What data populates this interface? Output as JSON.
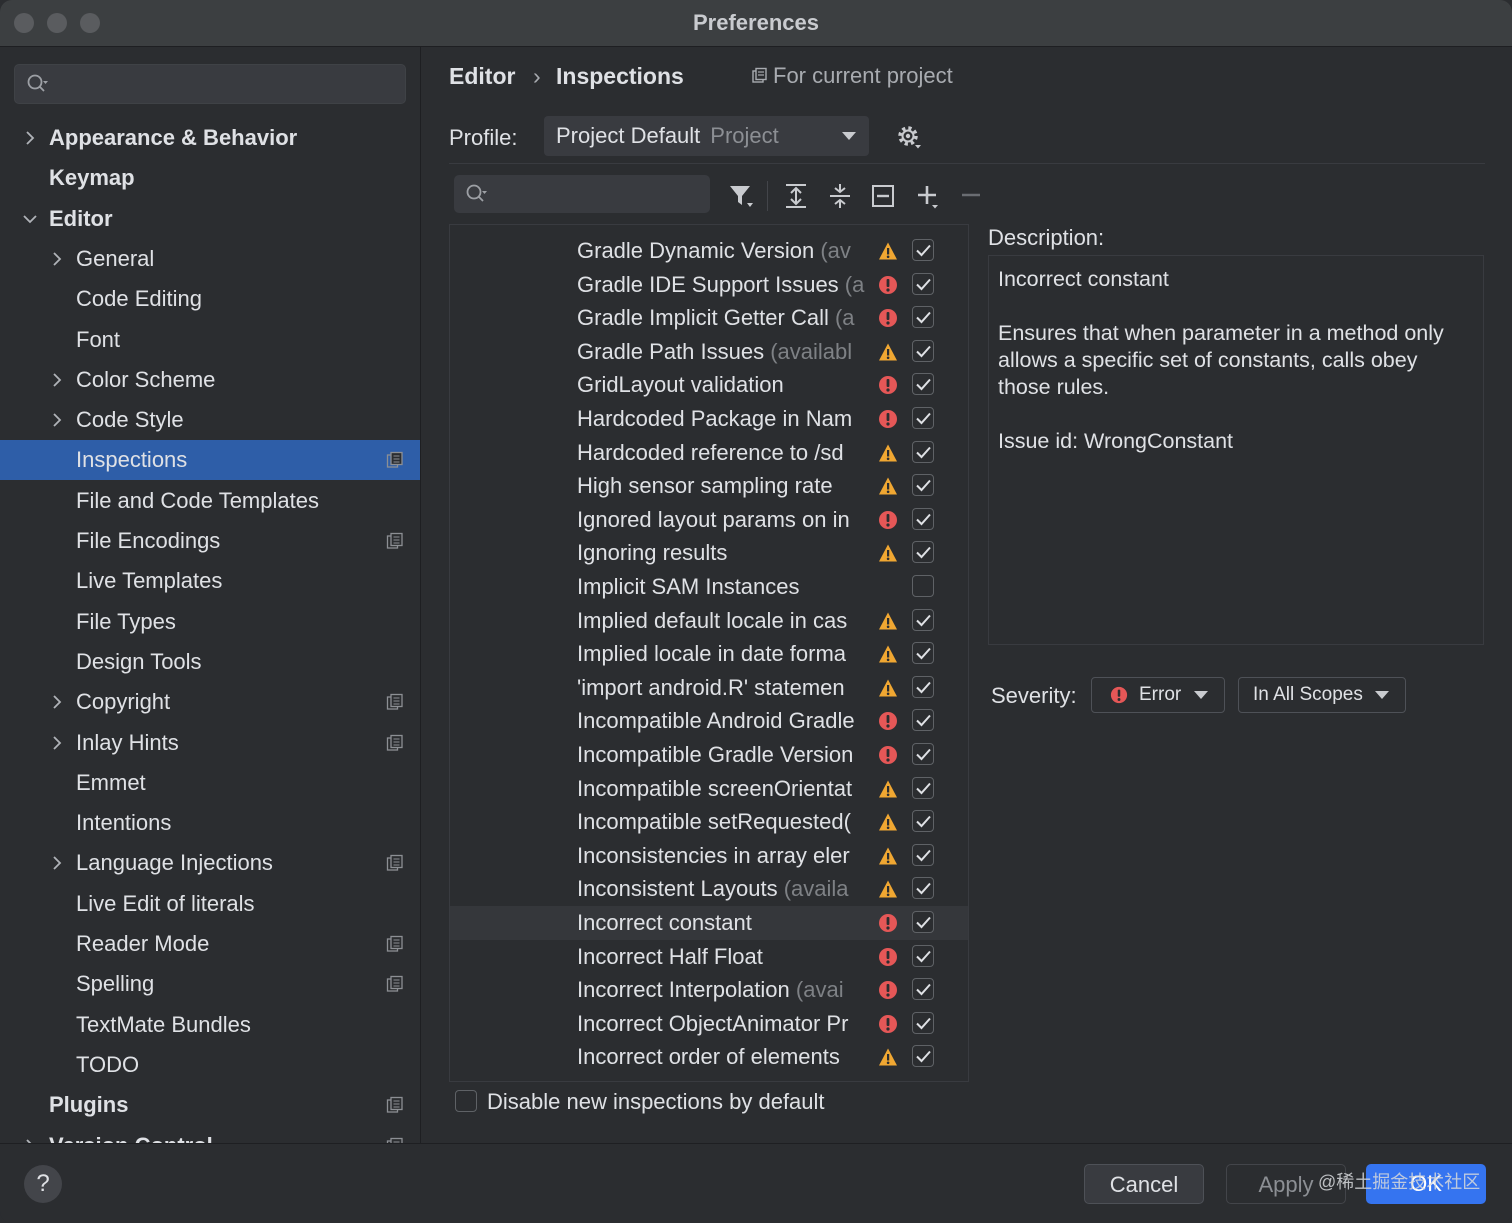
{
  "window": {
    "title": "Preferences"
  },
  "sidebar": {
    "search_placeholder": "",
    "items": [
      {
        "label": "Appearance & Behavior",
        "level": 0,
        "bold": true,
        "chevron": "right",
        "project": false
      },
      {
        "label": "Keymap",
        "level": 0,
        "bold": true,
        "chevron": "",
        "project": false
      },
      {
        "label": "Editor",
        "level": 0,
        "bold": true,
        "chevron": "down",
        "project": false
      },
      {
        "label": "General",
        "level": 1,
        "bold": false,
        "chevron": "right",
        "project": false
      },
      {
        "label": "Code Editing",
        "level": 1,
        "bold": false,
        "chevron": "",
        "project": false
      },
      {
        "label": "Font",
        "level": 1,
        "bold": false,
        "chevron": "",
        "project": false
      },
      {
        "label": "Color Scheme",
        "level": 1,
        "bold": false,
        "chevron": "right",
        "project": false
      },
      {
        "label": "Code Style",
        "level": 1,
        "bold": false,
        "chevron": "right",
        "project": false
      },
      {
        "label": "Inspections",
        "level": 1,
        "bold": false,
        "chevron": "",
        "project": true,
        "selected": true
      },
      {
        "label": "File and Code Templates",
        "level": 1,
        "bold": false,
        "chevron": "",
        "project": false
      },
      {
        "label": "File Encodings",
        "level": 1,
        "bold": false,
        "chevron": "",
        "project": true
      },
      {
        "label": "Live Templates",
        "level": 1,
        "bold": false,
        "chevron": "",
        "project": false
      },
      {
        "label": "File Types",
        "level": 1,
        "bold": false,
        "chevron": "",
        "project": false
      },
      {
        "label": "Design Tools",
        "level": 1,
        "bold": false,
        "chevron": "",
        "project": false
      },
      {
        "label": "Copyright",
        "level": 1,
        "bold": false,
        "chevron": "right",
        "project": true
      },
      {
        "label": "Inlay Hints",
        "level": 1,
        "bold": false,
        "chevron": "right",
        "project": true
      },
      {
        "label": "Emmet",
        "level": 1,
        "bold": false,
        "chevron": "",
        "project": false
      },
      {
        "label": "Intentions",
        "level": 1,
        "bold": false,
        "chevron": "",
        "project": false
      },
      {
        "label": "Language Injections",
        "level": 1,
        "bold": false,
        "chevron": "right",
        "project": true
      },
      {
        "label": "Live Edit of literals",
        "level": 1,
        "bold": false,
        "chevron": "",
        "project": false
      },
      {
        "label": "Reader Mode",
        "level": 1,
        "bold": false,
        "chevron": "",
        "project": true
      },
      {
        "label": "Spelling",
        "level": 1,
        "bold": false,
        "chevron": "",
        "project": true
      },
      {
        "label": "TextMate Bundles",
        "level": 1,
        "bold": false,
        "chevron": "",
        "project": false
      },
      {
        "label": "TODO",
        "level": 1,
        "bold": false,
        "chevron": "",
        "project": false
      },
      {
        "label": "Plugins",
        "level": 0,
        "bold": true,
        "chevron": "",
        "project": true
      },
      {
        "label": "Version Control",
        "level": 0,
        "bold": true,
        "chevron": "right",
        "project": true
      }
    ]
  },
  "breadcrumb": {
    "parent": "Editor",
    "separator": "›",
    "current": "Inspections",
    "note": "For current project"
  },
  "profile": {
    "label": "Profile:",
    "value": "Project Default",
    "sub": "Project"
  },
  "inspections": [
    {
      "name": "Gradle Dynamic Version",
      "hint": " (av",
      "severity": "warning",
      "checked": true
    },
    {
      "name": "Gradle IDE Support Issues",
      "hint": " (a",
      "severity": "error",
      "checked": true
    },
    {
      "name": "Gradle Implicit Getter Call",
      "hint": " (a",
      "severity": "error",
      "checked": true
    },
    {
      "name": "Gradle Path Issues",
      "hint": " (availabl",
      "severity": "warning",
      "checked": true
    },
    {
      "name": "GridLayout validation",
      "hint": "",
      "severity": "error",
      "checked": true
    },
    {
      "name": "Hardcoded Package in Nam",
      "hint": "",
      "severity": "error",
      "checked": true
    },
    {
      "name": "Hardcoded reference to /sd",
      "hint": "",
      "severity": "warning",
      "checked": true
    },
    {
      "name": "High sensor sampling rate",
      "hint": "",
      "severity": "warning",
      "checked": true
    },
    {
      "name": "Ignored layout params on in",
      "hint": "",
      "severity": "error",
      "checked": true
    },
    {
      "name": "Ignoring results",
      "hint": "",
      "severity": "warning",
      "checked": true
    },
    {
      "name": "Implicit SAM Instances",
      "hint": "",
      "severity": "none",
      "checked": false
    },
    {
      "name": "Implied default locale in cas",
      "hint": "",
      "severity": "warning",
      "checked": true
    },
    {
      "name": "Implied locale in date forma",
      "hint": "",
      "severity": "warning",
      "checked": true
    },
    {
      "name": "'import android.R' statemen",
      "hint": "",
      "severity": "warning",
      "checked": true
    },
    {
      "name": "Incompatible Android Gradle",
      "hint": "",
      "severity": "error",
      "checked": true
    },
    {
      "name": "Incompatible Gradle Version",
      "hint": "",
      "severity": "error",
      "checked": true
    },
    {
      "name": "Incompatible screenOrientat",
      "hint": "",
      "severity": "warning",
      "checked": true
    },
    {
      "name": "Incompatible setRequested(",
      "hint": "",
      "severity": "warning",
      "checked": true
    },
    {
      "name": "Inconsistencies in array eler",
      "hint": "",
      "severity": "warning",
      "checked": true
    },
    {
      "name": "Inconsistent Layouts",
      "hint": " (availa",
      "severity": "warning",
      "checked": true
    },
    {
      "name": "Incorrect constant",
      "hint": "",
      "severity": "error",
      "checked": true,
      "selected": true
    },
    {
      "name": "Incorrect Half Float",
      "hint": "",
      "severity": "error",
      "checked": true
    },
    {
      "name": "Incorrect Interpolation",
      "hint": " (avai",
      "severity": "error",
      "checked": true
    },
    {
      "name": "Incorrect ObjectAnimator Pr",
      "hint": "",
      "severity": "error",
      "checked": true
    },
    {
      "name": "Incorrect order of elements",
      "hint": "",
      "severity": "warning",
      "checked": true
    }
  ],
  "disable_new": {
    "label": "Disable new inspections by default",
    "checked": false
  },
  "description": {
    "label": "Description:",
    "title": "Incorrect constant",
    "body": "Ensures that when parameter in a method only allows a specific set of constants, calls obey those rules.",
    "issue": "Issue id: WrongConstant"
  },
  "severity": {
    "label": "Severity:",
    "value": "Error",
    "scope": "In All Scopes"
  },
  "footer": {
    "help": "?",
    "cancel": "Cancel",
    "apply": "Apply",
    "ok": "OK",
    "watermark": "@稀土掘金技术社区"
  },
  "colors": {
    "selection": "#2e5ea8",
    "warning": "#f0a732",
    "error": "#e55757",
    "ok_button": "#3574f0"
  }
}
